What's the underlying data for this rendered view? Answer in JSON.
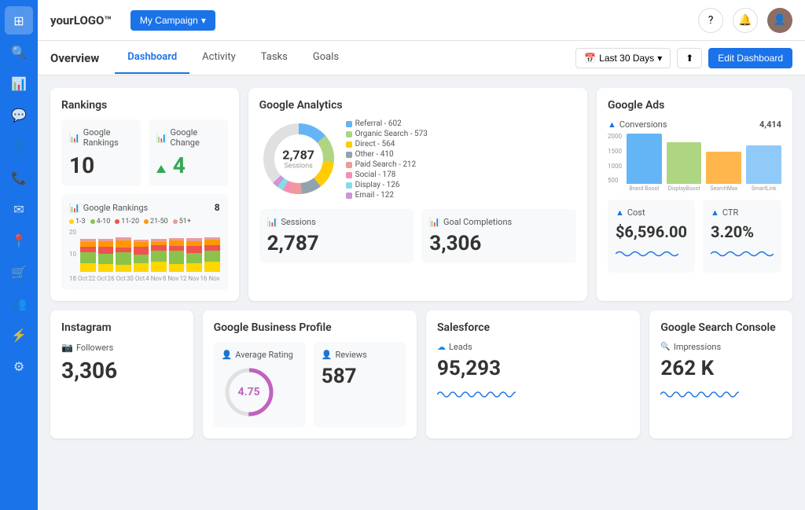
{
  "logo": {
    "text": "yourLOGO™"
  },
  "campaign": {
    "label": "My Campaign"
  },
  "topnav": {
    "help_icon": "?",
    "notif_icon": "🔔"
  },
  "subnav": {
    "title": "Overview",
    "tabs": [
      "Dashboard",
      "Activity",
      "Tasks",
      "Goals"
    ],
    "active_tab": "Dashboard",
    "date_label": "Last 30 Days",
    "edit_label": "Edit Dashboard"
  },
  "rankings": {
    "title": "Rankings",
    "google_rankings_label": "Google Rankings",
    "google_rankings_value": "10",
    "google_change_label": "Google Change",
    "google_change_value": "4",
    "chart_title": "Google Rankings",
    "chart_num": "8",
    "legend": [
      {
        "label": "1-3",
        "color": "#ffd600"
      },
      {
        "label": "4-10",
        "color": "#8bc34a"
      },
      {
        "label": "11-20",
        "color": "#ef5350"
      },
      {
        "label": "21-50",
        "color": "#ff9800"
      },
      {
        "label": "51+",
        "color": "#ef9a9a"
      }
    ],
    "chart_labels": [
      "18 Oct",
      "22 Oct",
      "26 Oct",
      "30 Oct",
      "4 Nov",
      "8 Nov",
      "12 Nov",
      "16 Nov"
    ]
  },
  "google_analytics": {
    "title": "Google Analytics",
    "sessions_label": "Sessions",
    "total_sessions": "2,787",
    "donut_segments": [
      {
        "label": "Referral",
        "value": 602,
        "color": "#64b5f6"
      },
      {
        "label": "Organic Search",
        "value": 573,
        "color": "#aed581"
      },
      {
        "label": "Direct",
        "value": 564,
        "color": "#ffcc02"
      },
      {
        "label": "Other",
        "value": 410,
        "color": "#90a4ae"
      },
      {
        "label": "Paid Search",
        "value": 212,
        "color": "#ef9a9a"
      },
      {
        "label": "Social",
        "value": 178,
        "color": "#f48fb1"
      },
      {
        "label": "Display",
        "value": 126,
        "color": "#80deea"
      },
      {
        "label": "Email",
        "value": 122,
        "color": "#ce93d8"
      }
    ],
    "sessions_stat_label": "Sessions",
    "sessions_stat_value": "2,787",
    "goal_completions_label": "Goal Completions",
    "goal_completions_value": "3,306"
  },
  "google_ads": {
    "title": "Google Ads",
    "conversions_label": "Conversions",
    "conversions_value": "4,414",
    "bars": [
      {
        "label": "Brand Boost",
        "value": 1700,
        "color": "#64b5f6"
      },
      {
        "label": "DisplayBoost",
        "value": 1400,
        "color": "#aed581"
      },
      {
        "label": "SearchMax",
        "value": 1100,
        "color": "#ffb74d"
      },
      {
        "label": "SmartLink",
        "value": 1300,
        "color": "#90caf9"
      }
    ],
    "y_labels": [
      "2000",
      "1500",
      "1000",
      "500",
      ""
    ],
    "cost_label": "Cost",
    "cost_value": "$6,596.00",
    "ctr_label": "CTR",
    "ctr_value": "3.20%"
  },
  "instagram": {
    "title": "Instagram",
    "followers_label": "Followers",
    "followers_value": "3,306"
  },
  "gbp": {
    "title": "Google Business Profile",
    "avg_rating_label": "Average Rating",
    "avg_rating_value": "4.75",
    "reviews_label": "Reviews",
    "reviews_value": "587"
  },
  "salesforce": {
    "title": "Salesforce",
    "leads_label": "Leads",
    "leads_value": "95,293"
  },
  "gsc": {
    "title": "Google Search Console",
    "impressions_label": "Impressions",
    "impressions_value": "262 K"
  }
}
